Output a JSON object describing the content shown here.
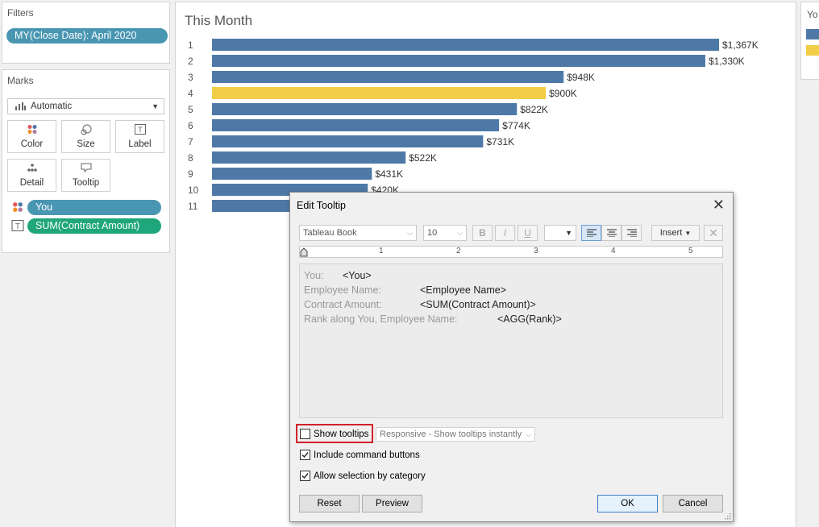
{
  "filters": {
    "title": "Filters",
    "pill": "MY(Close Date): April 2020"
  },
  "marks": {
    "title": "Marks",
    "mark_type": "Automatic",
    "buttons": [
      {
        "label": "Color",
        "icon": "color-icon"
      },
      {
        "label": "Size",
        "icon": "size-icon"
      },
      {
        "label": "Label",
        "icon": "label-icon"
      },
      {
        "label": "Detail",
        "icon": "detail-icon"
      },
      {
        "label": "Tooltip",
        "icon": "tooltip-icon"
      }
    ],
    "shelf": [
      {
        "label": "You",
        "icon": "color-icon",
        "type": "dimension"
      },
      {
        "label": "SUM(Contract Amount)",
        "icon": "label-icon",
        "type": "measure"
      }
    ]
  },
  "chart_data": {
    "type": "bar",
    "title": "This Month",
    "categories": [
      "1",
      "2",
      "3",
      "4",
      "5",
      "6",
      "7",
      "8",
      "9",
      "10",
      "11"
    ],
    "values": [
      1367,
      1330,
      948,
      900,
      822,
      774,
      731,
      522,
      431,
      420,
      null
    ],
    "value_labels": [
      "$1,367K",
      "$1,330K",
      "$948K",
      "$900K",
      "$822K",
      "$774K",
      "$731K",
      "$522K",
      "$431K",
      "$420K",
      ""
    ],
    "highlight_index": 3,
    "colors": {
      "default": "#4e79a7",
      "highlight": "#f1ce46"
    },
    "xlabel": "",
    "ylabel": ""
  },
  "legend": {
    "title": "Yo",
    "colors": [
      "#4e79a7",
      "#f1ce46"
    ]
  },
  "dialog": {
    "title": "Edit Tooltip",
    "toolbar": {
      "font": "Tableau Book",
      "size": "10",
      "bold": "B",
      "italic": "I",
      "underline": "U",
      "insert": "Insert"
    },
    "ruler": [
      "1",
      "2",
      "3",
      "4",
      "5"
    ],
    "editor": [
      {
        "label": "You:",
        "value": "<You>"
      },
      {
        "label": "Employee Name:",
        "value": "<Employee Name>"
      },
      {
        "label": "Contract Amount:",
        "value": "<SUM(Contract Amount)>"
      },
      {
        "label": "Rank along You, Employee Name:",
        "value": "<AGG(Rank)>"
      }
    ],
    "show_tooltips": {
      "label": "Show tooltips",
      "checked": false
    },
    "responsive": "Responsive - Show tooltips instantly",
    "include_command": {
      "label": "Include command buttons",
      "checked": true
    },
    "allow_selection": {
      "label": "Allow selection by category",
      "checked": true
    },
    "buttons": {
      "reset": "Reset",
      "preview": "Preview",
      "ok": "OK",
      "cancel": "Cancel"
    }
  }
}
